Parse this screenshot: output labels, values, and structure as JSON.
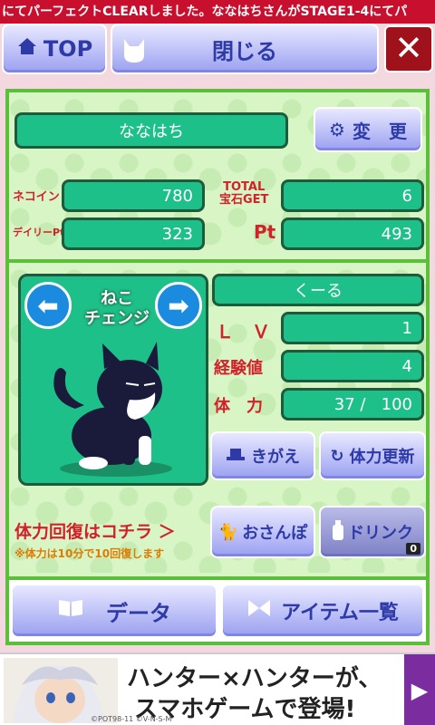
{
  "ticker": "にてパーフェクトCLEARしました。ななはちさんがSTAGE1-4にてパ",
  "topbar": {
    "top_label": "TOP",
    "close_label": "閉じる",
    "x_label": "✕"
  },
  "profile": {
    "name": "ななはち",
    "change_label": "変　更",
    "neko_coin_label": "ネコイン",
    "neko_coin": "780",
    "total_label": "TOTAL",
    "gem_label": "宝石GET",
    "gem": "6",
    "daily_pt_label": "デイリーPt",
    "daily_pt": "323",
    "pt_label": "Pt",
    "pt": "493"
  },
  "cat": {
    "change_line1": "ねこ",
    "change_line2": "チェンジ",
    "name": "くーる",
    "lv_label": "Ｌ　Ｖ",
    "lv": "1",
    "exp_label": "経験値",
    "exp": "4",
    "hp_label": "体　力",
    "hp": "37 /   100",
    "dress_label": "きがえ",
    "refresh_label": "体力更新",
    "recover_label": "体力回復はコチラ ＞",
    "recover_note": "※体力は10分で10回復します",
    "walk_label": "おさんぽ",
    "drink_label": "ドリンク",
    "drink_count": "0"
  },
  "bottom": {
    "data_label": "データ",
    "items_label": "アイテム一覧"
  },
  "ad": {
    "line1": "ハンター×ハンターが、",
    "line2": "スマホゲームで登場!",
    "credit": "©POT98-11 ©V-N-S-M"
  },
  "colors": {
    "field": "#1ec08a",
    "panel": "#d8f5c6",
    "border": "#5cbf3a",
    "accent_red": "#d1212a",
    "button": "#9aa0f0"
  }
}
